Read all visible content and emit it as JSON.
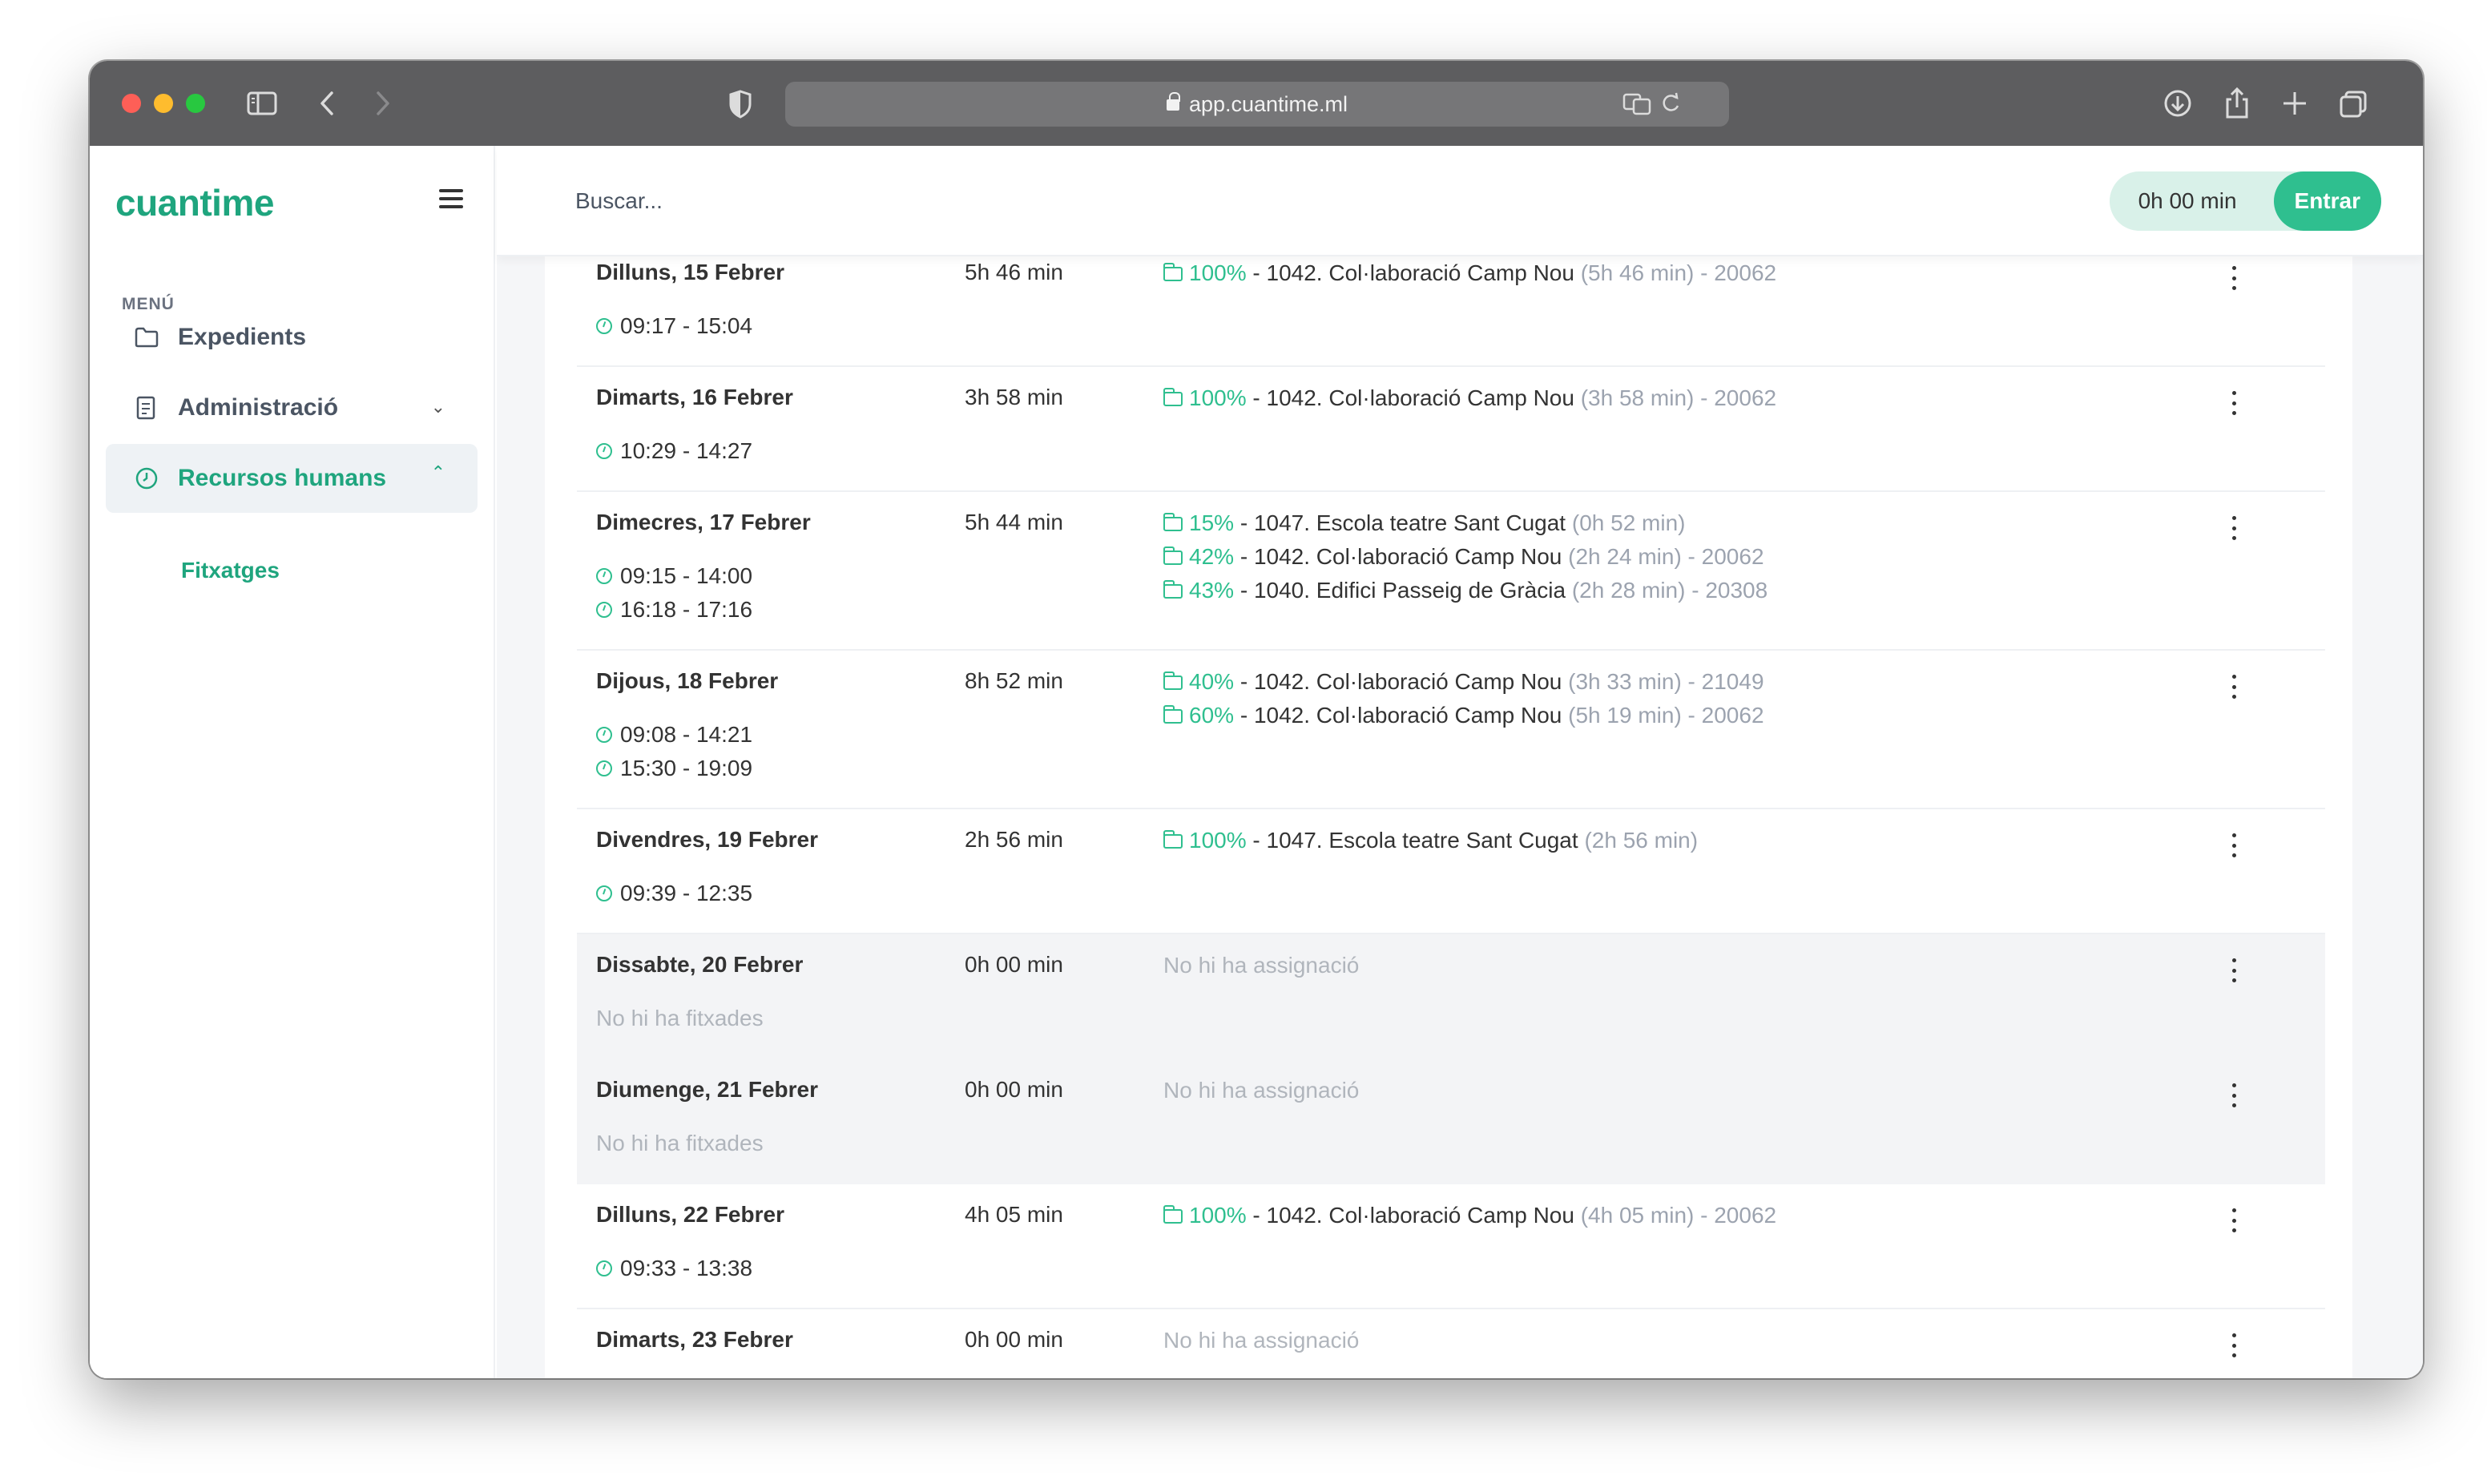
{
  "browser": {
    "url": "app.cuantime.ml"
  },
  "sidebar": {
    "logo": "cuantime",
    "menu_label": "MENÚ",
    "items": [
      {
        "label": "Expedients",
        "icon": "folder-icon"
      },
      {
        "label": "Administració",
        "icon": "document-icon"
      },
      {
        "label": "Recursos humans",
        "icon": "clock-icon"
      }
    ],
    "subitem": "Fitxatges"
  },
  "topbar": {
    "search_placeholder": "Buscar...",
    "timer": "0h 00 min",
    "enter_label": "Entrar"
  },
  "days": [
    {
      "day": "Dilluns, 15 Febrer",
      "total": "5h 46 min",
      "intervals": [
        "09:17 - 15:04"
      ],
      "assignments": [
        {
          "pct": "100%",
          "project": "1042. Col·laboració Camp Nou",
          "dur": "(5h 46 min) - 20062"
        }
      ]
    },
    {
      "day": "Dimarts, 16 Febrer",
      "total": "3h 58 min",
      "intervals": [
        "10:29 - 14:27"
      ],
      "assignments": [
        {
          "pct": "100%",
          "project": "1042. Col·laboració Camp Nou",
          "dur": "(3h 58 min) - 20062"
        }
      ]
    },
    {
      "day": "Dimecres, 17 Febrer",
      "total": "5h 44 min",
      "intervals": [
        "09:15 - 14:00",
        "16:18 - 17:16"
      ],
      "assignments": [
        {
          "pct": "15%",
          "project": "1047. Escola teatre Sant Cugat",
          "dur": "(0h 52 min)"
        },
        {
          "pct": "42%",
          "project": "1042. Col·laboració Camp Nou",
          "dur": "(2h 24 min) - 20062"
        },
        {
          "pct": "43%",
          "project": "1040. Edifici Passeig de Gràcia",
          "dur": "(2h 28 min) - 20308"
        }
      ]
    },
    {
      "day": "Dijous, 18 Febrer",
      "total": "8h 52 min",
      "intervals": [
        "09:08 - 14:21",
        "15:30 - 19:09"
      ],
      "assignments": [
        {
          "pct": "40%",
          "project": "1042. Col·laboració Camp Nou",
          "dur": "(3h 33 min) - 21049"
        },
        {
          "pct": "60%",
          "project": "1042. Col·laboració Camp Nou",
          "dur": "(5h 19 min) - 20062"
        }
      ]
    },
    {
      "day": "Divendres, 19 Febrer",
      "total": "2h 56 min",
      "intervals": [
        "09:39 - 12:35"
      ],
      "assignments": [
        {
          "pct": "100%",
          "project": "1047. Escola teatre Sant Cugat",
          "dur": "(2h 56 min)"
        }
      ]
    },
    {
      "day": "Dissabte, 20 Febrer",
      "total": "0h 00 min",
      "no_intervals": "No hi ha fitxades",
      "no_assign": "No hi ha assignació"
    },
    {
      "day": "Diumenge, 21 Febrer",
      "total": "0h 00 min",
      "no_intervals": "No hi ha fitxades",
      "no_assign": "No hi ha assignació"
    },
    {
      "day": "Dilluns, 22 Febrer",
      "total": "4h 05 min",
      "intervals": [
        "09:33 - 13:38"
      ],
      "assignments": [
        {
          "pct": "100%",
          "project": "1042. Col·laboració Camp Nou",
          "dur": "(4h 05 min) - 20062"
        }
      ]
    },
    {
      "day": "Dimarts, 23 Febrer",
      "total": "0h 00 min",
      "no_assign": "No hi ha assignació"
    }
  ]
}
